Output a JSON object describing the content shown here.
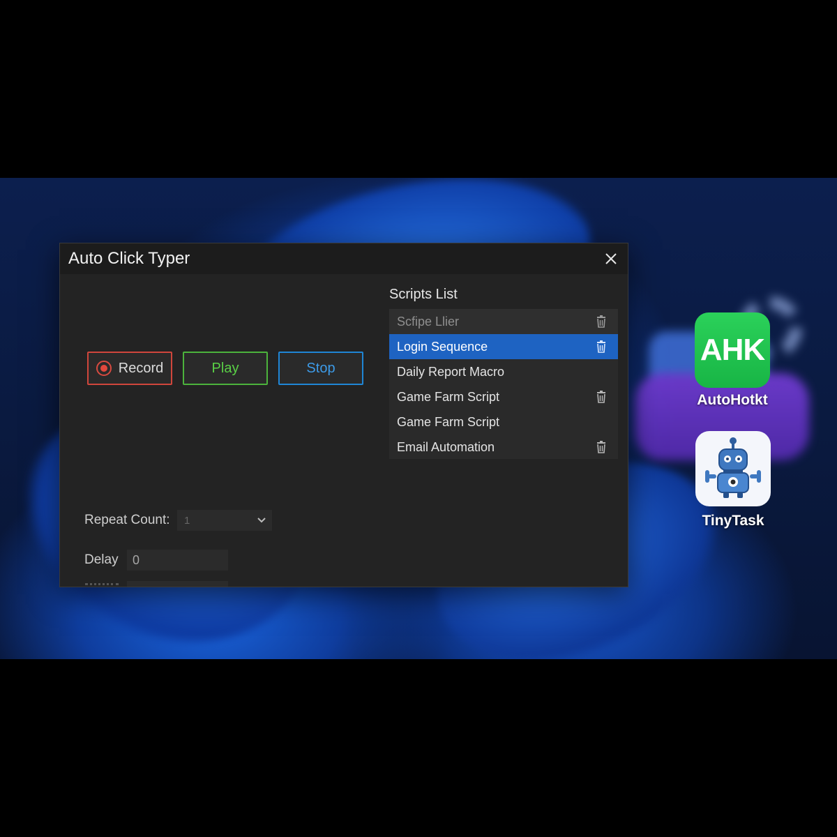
{
  "window": {
    "title": "Auto Click Typer"
  },
  "controls": {
    "record_label": "Record",
    "play_label": "Play",
    "stop_label": "Stop"
  },
  "scripts": {
    "title": "Scripts List",
    "header_label": "Scfipe Llier",
    "items": [
      {
        "label": "Login Sequence",
        "selected": true
      },
      {
        "label": "Daily Report Macro"
      },
      {
        "label": "Game Farm Script"
      },
      {
        "label": "Game Farm Script"
      },
      {
        "label": "Email Automation"
      }
    ]
  },
  "settings": {
    "repeat_label": "Repeat Count:",
    "repeat_value": "1",
    "delay_label": "Delay",
    "delay_value": "0"
  },
  "desktop_icons": [
    {
      "label": "AutoHotkt",
      "tile_text": "AHK",
      "icon": "ahk-icon"
    },
    {
      "label": "TinyTask",
      "icon": "robot-icon"
    }
  ],
  "colors": {
    "record": "#d0463c",
    "play": "#4cb33c",
    "stop": "#1f86d6",
    "selection": "#1e63c2",
    "ahk_green": "#22c34f"
  }
}
